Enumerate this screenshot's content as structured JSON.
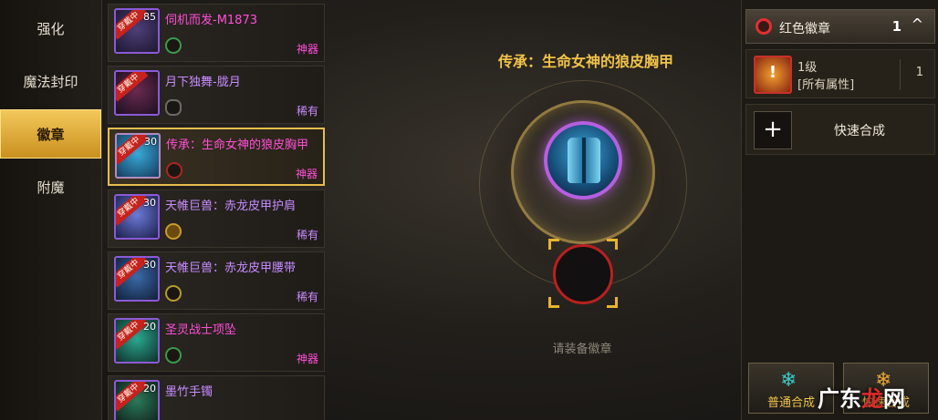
{
  "nav": [
    {
      "label": "强化",
      "active": false
    },
    {
      "label": "魔法封印",
      "active": false
    },
    {
      "label": "徽章",
      "active": true
    },
    {
      "label": "附魔",
      "active": false
    }
  ],
  "items": [
    {
      "name": "伺机而发-M1873",
      "rarity": "神器",
      "level": "85",
      "badge": "穿戴中",
      "color": "pink"
    },
    {
      "name": "月下独舞-胧月",
      "rarity": "稀有",
      "level": "",
      "badge": "穿戴中",
      "color": "purple"
    },
    {
      "name": "传承：生命女神的狼皮胸甲",
      "rarity": "神器",
      "level": "30",
      "badge": "穿戴中",
      "color": "pink",
      "selected": true
    },
    {
      "name": "天帷巨兽：赤龙皮甲护肩",
      "rarity": "稀有",
      "level": "30",
      "badge": "穿戴中",
      "color": "purple"
    },
    {
      "name": "天帷巨兽：赤龙皮甲腰带",
      "rarity": "稀有",
      "level": "30",
      "badge": "穿戴中",
      "color": "purple"
    },
    {
      "name": "圣灵战士项坠",
      "rarity": "神器",
      "level": "20",
      "badge": "穿戴中",
      "color": "pink"
    },
    {
      "name": "墨竹手镯",
      "rarity": "",
      "level": "20",
      "badge": "穿戴中",
      "color": "purple"
    }
  ],
  "center": {
    "title": "传承：生命女神的狼皮胸甲",
    "hint": "请装备徽章"
  },
  "right": {
    "header_title": "红色徽章",
    "header_count": "1",
    "entry_level": "1级",
    "entry_attr": "[所有属性]",
    "entry_count": "1",
    "quick_label": "快速合成",
    "btn_normal": "普通合成",
    "btn_fast": "快速合成"
  },
  "watermark": {
    "part1": "广东",
    "part2": "龙",
    "part3": "网"
  },
  "colors": {
    "accent": "#f0c34a",
    "artifact": "#ff4fd8",
    "rare": "#c88cff",
    "badge_red": "#e03030"
  }
}
